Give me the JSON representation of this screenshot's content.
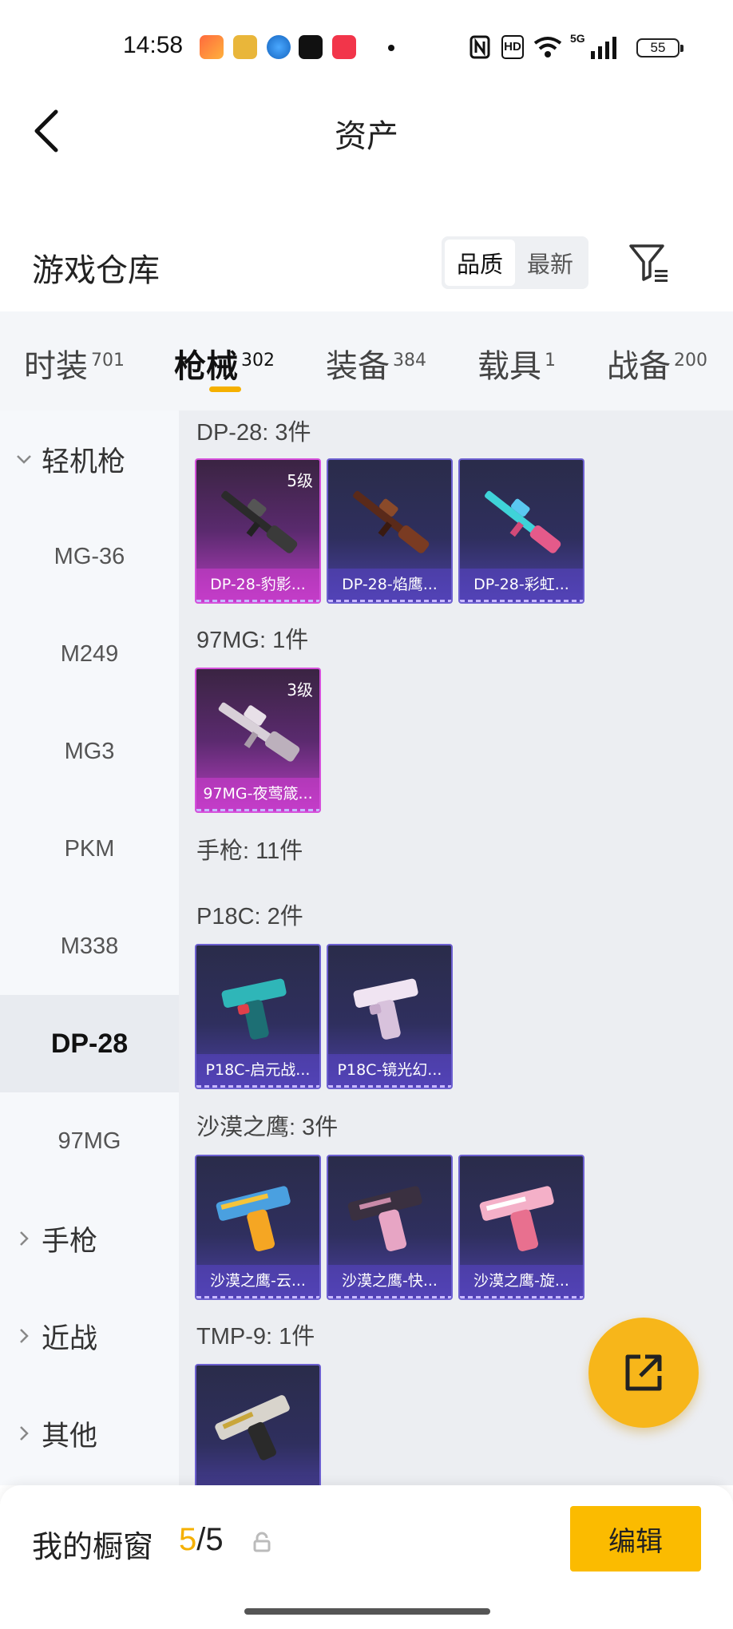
{
  "status": {
    "time": "14:58",
    "battery": "55",
    "signal": "5G",
    "hd": "HD"
  },
  "header": {
    "title": "资产"
  },
  "warehouse": {
    "title": "游戏仓库",
    "sort": [
      "品质",
      "最新"
    ]
  },
  "tabs": [
    {
      "label": "时装",
      "count": "701"
    },
    {
      "label": "枪械",
      "count": "302"
    },
    {
      "label": "装备",
      "count": "384"
    },
    {
      "label": "载具",
      "count": "1"
    },
    {
      "label": "战备",
      "count": "200"
    }
  ],
  "sidebar": {
    "group_lmg": "轻机枪",
    "items": [
      "MG-36",
      "M249",
      "MG3",
      "PKM",
      "M338",
      "DP-28",
      "97MG"
    ],
    "group_pistol": "手枪",
    "group_melee": "近战",
    "group_other": "其他"
  },
  "content": {
    "dp28_title": "DP-28: 3件",
    "dp28_cards": [
      "DP-28-豹影...",
      "DP-28-焰鹰...",
      "DP-28-彩虹..."
    ],
    "dp28_level": "5级",
    "mg97_title": "97MG: 1件",
    "mg97_cards": [
      "97MG-夜莺箴..."
    ],
    "mg97_level": "3级",
    "pistol_title": "手枪: 11件",
    "p18c_title": "P18C: 2件",
    "p18c_cards": [
      "P18C-启元战...",
      "P18C-镜光幻..."
    ],
    "deagle_title": "沙漠之鹰: 3件",
    "deagle_cards": [
      "沙漠之鹰-云...",
      "沙漠之鹰-快...",
      "沙漠之鹰-旋..."
    ],
    "tmp9_title": "TMP-9: 1件"
  },
  "bottom": {
    "label": "我的橱窗",
    "current": "5",
    "total": "/5",
    "edit": "编辑"
  },
  "colors": {
    "accent": "#f5b000",
    "fab": "#f7b61a"
  },
  "icons": [
    "back-icon",
    "filter-icon",
    "chevron-down-icon",
    "chevron-right-icon",
    "share-icon",
    "lock-icon"
  ]
}
